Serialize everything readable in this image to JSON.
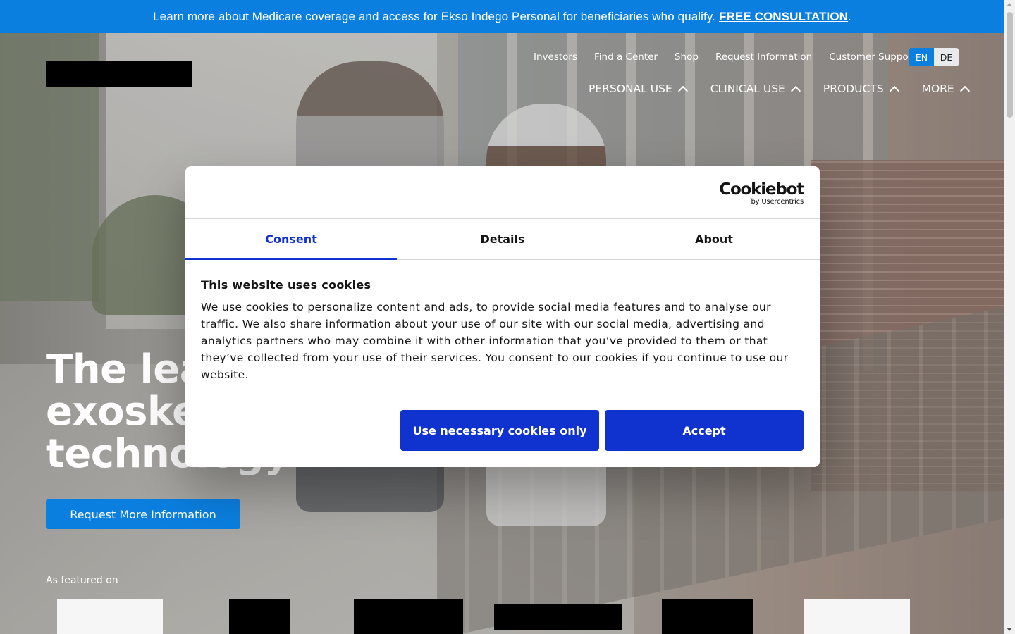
{
  "announcement": {
    "text": "Learn more about Medicare coverage and access for Ekso Indego Personal for beneficiaries who qualify.",
    "link": "FREE CONSULTATION",
    "suffix": "."
  },
  "utility_nav": [
    "Investors",
    "Find a Center",
    "Shop",
    "Request Information",
    "Customer Support"
  ],
  "languages": {
    "active": "EN",
    "other": "DE"
  },
  "main_nav": [
    "PERSONAL USE",
    "CLINICAL USE",
    "PRODUCTS",
    "MORE"
  ],
  "hero": {
    "headline_line1": "The lea",
    "headline_line2": "exoske",
    "headline_line3": "technology",
    "cta": "Request More Information",
    "featured_label": "As featured on"
  },
  "cookie_dialog": {
    "brand": "Cookiebot",
    "brand_sub": "by Usercentrics",
    "tabs": [
      "Consent",
      "Details",
      "About"
    ],
    "active_tab": "Consent",
    "title": "This website uses cookies",
    "body": "We use cookies to personalize content and ads, to provide social media features and to analyse our traffic. We also share information about your use of our site with our social media, advertising and analytics partners who may combine it with other information that you’ve provided to them or that they’ve collected from your use of their services. You consent to our cookies if you continue to use our website.",
    "btn_necessary": "Use necessary cookies only",
    "btn_accept": "Accept"
  },
  "colors": {
    "announce_blue": "#0b7fe0",
    "cookie_blue": "#1032cf"
  }
}
